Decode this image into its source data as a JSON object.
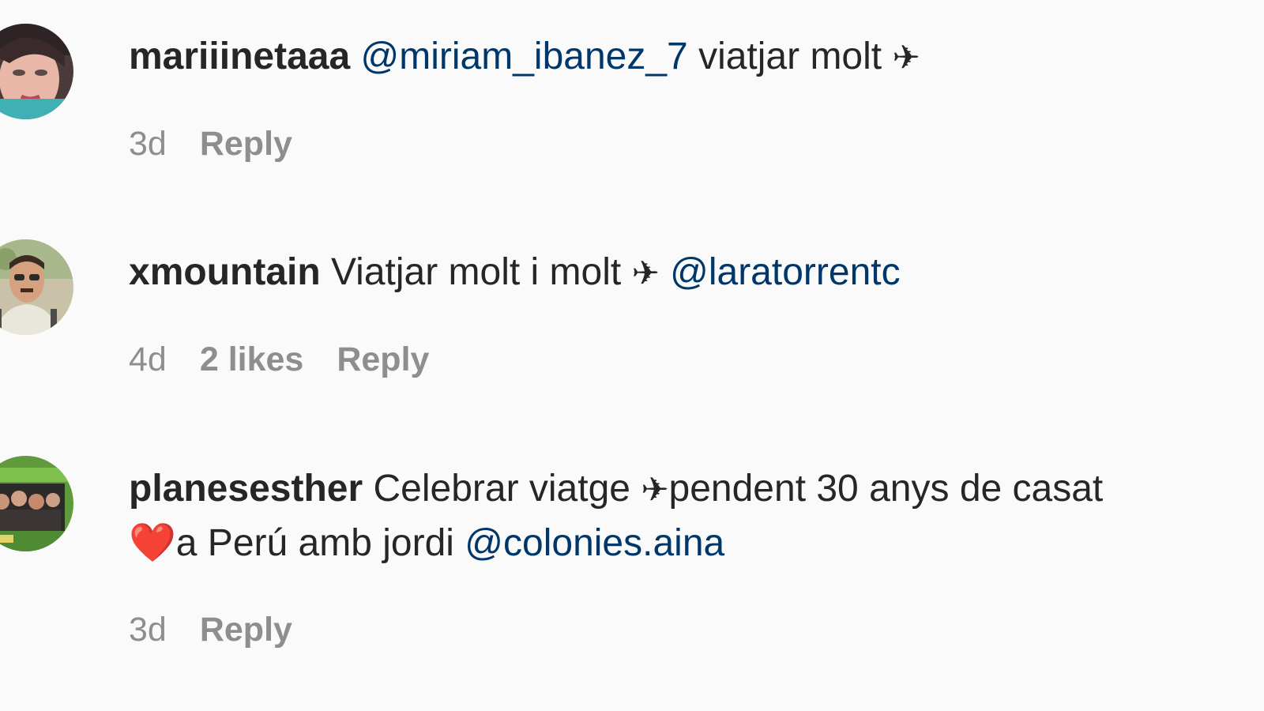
{
  "comments": [
    {
      "username": "mariiinetaaa",
      "mention_before": "@miriam_ibanez_7",
      "text": " viatjar molt ",
      "emoji": "✈",
      "time": "3d",
      "reply_label": "Reply"
    },
    {
      "username": "xmountain",
      "text": " Viatjar molt i molt ",
      "emoji": "✈",
      "mention_after": " @laratorrentc",
      "time": "4d",
      "likes": "2 likes",
      "reply_label": "Reply"
    },
    {
      "username": "planesesther",
      "text": " Celebrar viatge ",
      "emoji": "✈",
      "text2": "pendent 30 anys de casat",
      "heart": "❤️",
      "text3": "a Perú amb jordi ",
      "mention_after": "@colonies.aina",
      "time": "3d",
      "reply_label": "Reply"
    }
  ],
  "colors": {
    "background": "#fafafa",
    "text": "#262626",
    "mention": "#00376b",
    "meta": "#8e8e8e"
  }
}
